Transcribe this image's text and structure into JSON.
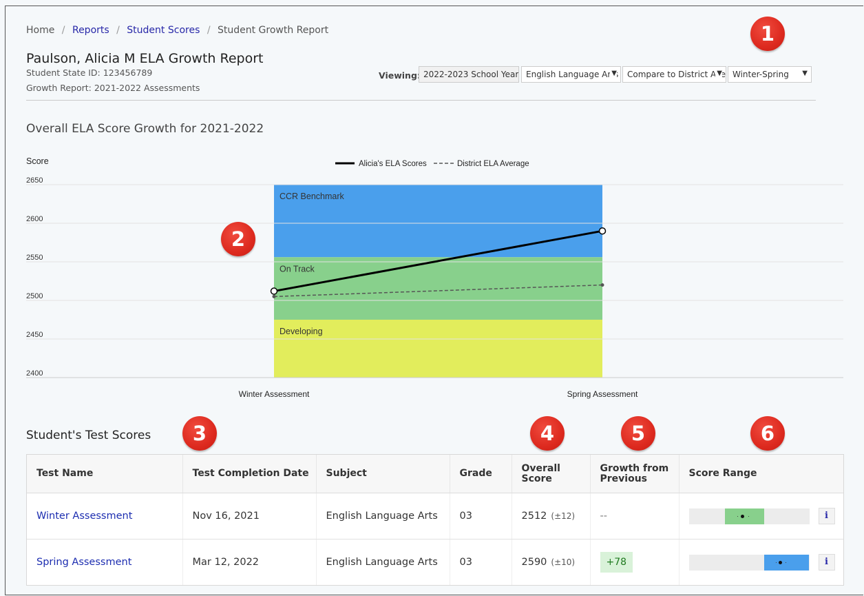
{
  "breadcrumb": {
    "home": "Home",
    "reports": "Reports",
    "student_scores": "Student Scores",
    "current": "Student Growth Report",
    "sep": "/"
  },
  "header": {
    "title": "Paulson, Alicia M ELA Growth Report",
    "state_id": "Student State ID: 123456789",
    "growth_report": "Growth Report: 2021-2022 Assessments"
  },
  "filters": {
    "viewing_label": "Viewing:",
    "school_year": "2022-2023 School Year",
    "subject": "English Language Arts",
    "compare": "Compare to District Average",
    "period": "Winter-Spring"
  },
  "badges": [
    "1",
    "2",
    "3",
    "4",
    "5",
    "6"
  ],
  "chart_section_title": "Overall ELA Score Growth for 2021-2022",
  "chart_data": {
    "type": "line",
    "ylabel": "Score",
    "ylim": [
      2400,
      2650
    ],
    "yticks": [
      2400,
      2450,
      2500,
      2550,
      2600,
      2650
    ],
    "categories": [
      "Winter Assessment",
      "Spring  Assessment"
    ],
    "series": [
      {
        "name": "Alicia's ELA Scores",
        "values": [
          2512,
          2590
        ],
        "style": "solid",
        "color": "#000000"
      },
      {
        "name": "District ELA Average",
        "values": [
          2505,
          2520
        ],
        "style": "dashed",
        "color": "#555555"
      }
    ],
    "bands": [
      {
        "label": "CCR Benchmark",
        "from": 2556,
        "to": 2650,
        "color": "#4a9fec"
      },
      {
        "label": "On Track",
        "from": 2475,
        "to": 2556,
        "color": "#88d08c"
      },
      {
        "label": "Developing",
        "from": 2400,
        "to": 2475,
        "color": "#e2ed5c"
      }
    ],
    "legend": "top-center",
    "grid": true
  },
  "scores": {
    "title": "Student's Test Scores",
    "columns": {
      "test_name": "Test Name",
      "date": "Test Completion Date",
      "subject": "Subject",
      "grade": "Grade",
      "overall": "Overall Score",
      "growth": "Growth from Previous",
      "range": "Score Range"
    },
    "rows": [
      {
        "test": "Winter Assessment",
        "date": "Nov 16, 2021",
        "subject": "English Language Arts",
        "grade": "03",
        "score": "2512",
        "pm": "(±12)",
        "growth": "--",
        "range_color": "#88d08c",
        "range_score": 2512,
        "range_margin": 12
      },
      {
        "test": "Spring Assessment",
        "date": "Mar 12, 2022",
        "subject": "English Language Arts",
        "grade": "03",
        "score": "2590",
        "pm": "(±10)",
        "growth": "+78",
        "range_color": "#4a9fec",
        "range_score": 2590,
        "range_margin": 10
      }
    ],
    "info_label": "i"
  },
  "colors": {
    "link": "#1c2db0",
    "badge": "#dd2a1f",
    "ccr": "#4a9fec",
    "on_track": "#88d08c",
    "developing": "#e2ed5c",
    "growth_bg": "#d9f2d9"
  }
}
